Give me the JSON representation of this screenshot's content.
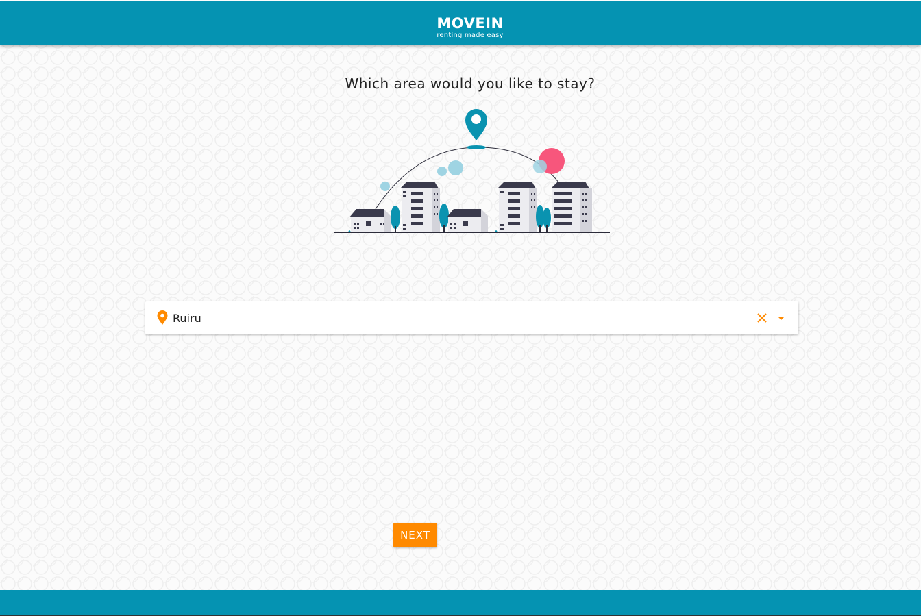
{
  "header": {
    "logo_text": "MOVEIN",
    "tagline": "renting made easy"
  },
  "main": {
    "question": "Which area would you like to stay?",
    "location_input": {
      "value": "Ruiru",
      "icon": "location-pin-icon"
    },
    "clear_icon": "close-icon",
    "dropdown_icon": "caret-down-icon",
    "next_button": "NEXT"
  },
  "colors": {
    "brand": "#0593b2",
    "accent": "#ff8a00",
    "pin_teal": "#0a93b0",
    "sun_pink": "#f7567c",
    "building_gray": "#d9d9de",
    "roof_dark": "#3a3a4c"
  }
}
